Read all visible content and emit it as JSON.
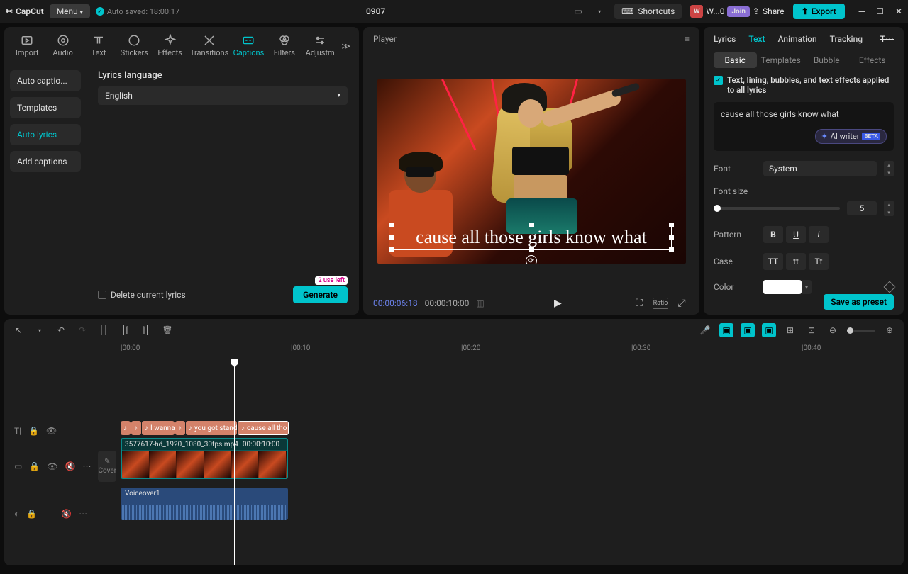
{
  "app_name": "CapCut",
  "menu_label": "Menu",
  "autosave": "Auto saved: 18:00:17",
  "project_title": "0907",
  "shortcuts_label": "Shortcuts",
  "user_initial": "W",
  "user_label": "W...0",
  "join_label": "Join",
  "share_label": "Share",
  "export_label": "Export",
  "tabs": {
    "import": "Import",
    "audio": "Audio",
    "text": "Text",
    "stickers": "Stickers",
    "effects": "Effects",
    "transitions": "Transitions",
    "captions": "Captions",
    "filters": "Filters",
    "adjust": "Adjustm"
  },
  "sidebar": {
    "auto_captions": "Auto captio...",
    "templates": "Templates",
    "auto_lyrics": "Auto lyrics",
    "add_captions": "Add captions"
  },
  "lyrics_lang_title": "Lyrics language",
  "lyrics_lang_value": "English",
  "delete_lyrics": "Delete current lyrics",
  "uses_left": "2 use left",
  "generate": "Generate",
  "player_title": "Player",
  "caption_text": "cause all those girls know what",
  "time_current": "00:00:06:18",
  "time_total": "00:00:10:00",
  "ratio_label": "Ratio",
  "right_tabs": {
    "lyrics": "Lyrics",
    "text": "Text",
    "animation": "Animation",
    "tracking": "Tracking"
  },
  "sub_tabs": {
    "basic": "Basic",
    "templates": "Templates",
    "bubble": "Bubble",
    "effects": "Effects"
  },
  "info_text": "Text, lining, bubbles, and text effects applied to all lyrics",
  "lyric_value": "cause all those girls know what",
  "ai_writer": "AI writer",
  "ai_beta": "BETA",
  "props": {
    "font": "Font",
    "font_value": "System",
    "font_size": "Font size",
    "font_size_value": "5",
    "pattern": "Pattern",
    "case": "Case",
    "color": "Color"
  },
  "fmt": {
    "bold": "B",
    "underline": "U",
    "italic": "I",
    "upper": "TT",
    "lower": "tt",
    "title": "Tt"
  },
  "save_preset": "Save as preset",
  "ruler": [
    "00:00",
    "00:10",
    "00:20",
    "00:30",
    "00:40"
  ],
  "captions_clips": [
    "",
    "",
    "I wanna",
    "",
    "you got standa",
    "cause all tho"
  ],
  "video_name": "3577617-hd_1920_1080_30fps.mp4",
  "video_dur": "00:00:10:00",
  "audio_name": "Voiceover1",
  "cover": "Cover"
}
